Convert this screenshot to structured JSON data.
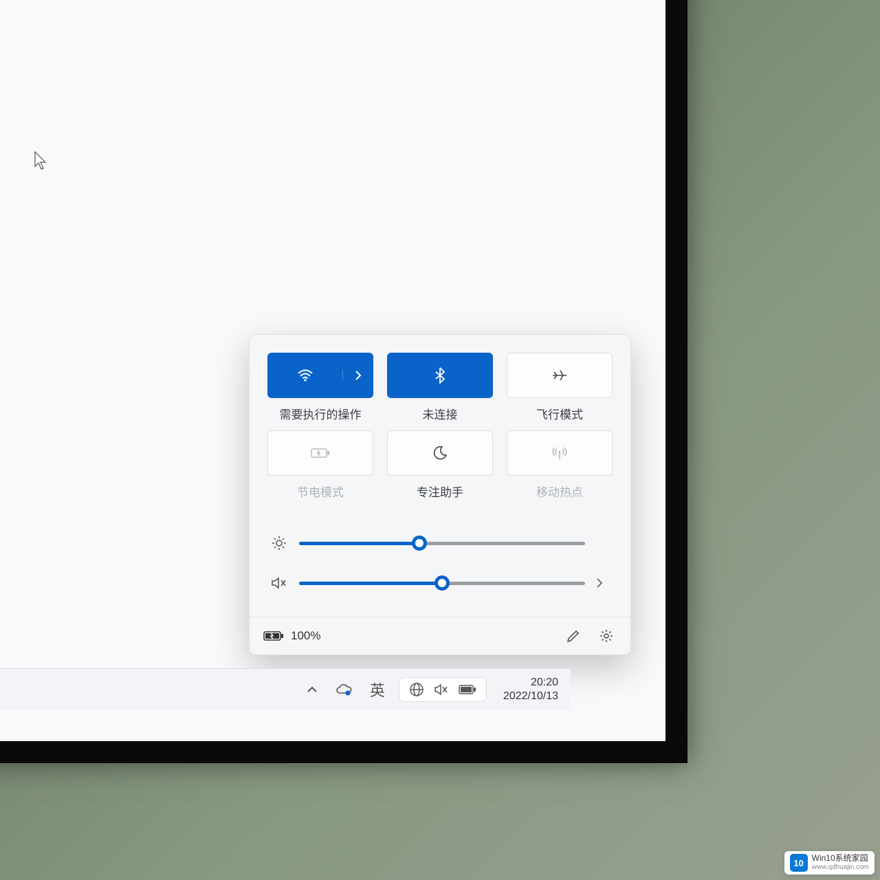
{
  "quick_settings": {
    "wifi": {
      "label": "需要执行的操作",
      "active": true
    },
    "bluetooth": {
      "label": "未连接",
      "active": true
    },
    "airplane": {
      "label": "飞行模式",
      "active": false
    },
    "battery_saver": {
      "label": "节电模式",
      "active": false,
      "disabled": true
    },
    "focus": {
      "label": "专注助手",
      "active": false
    },
    "hotspot": {
      "label": "移动热点",
      "active": false,
      "disabled": true
    },
    "brightness_pct": 42,
    "volume_pct": 50,
    "battery_text": "100%"
  },
  "taskbar": {
    "ime": "英",
    "time": "20:20",
    "date": "2022/10/13"
  },
  "watermark": {
    "badge": "10",
    "line1": "Win10系统家园",
    "line2": "www.qdhuajin.com"
  }
}
